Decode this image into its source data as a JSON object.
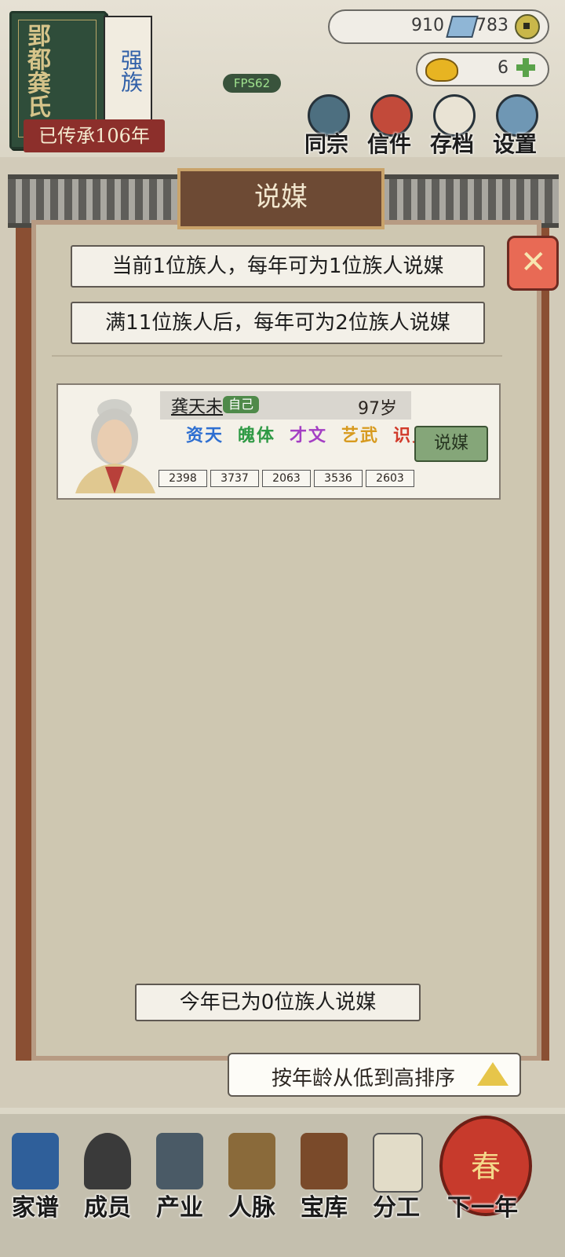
{
  "header": {
    "book_title": "郢都龚氏",
    "book_subtitle": "强族",
    "inheritance": "已传承106年",
    "resource_a": "910",
    "resource_b": "783",
    "gold": "6",
    "fps": "FPS62",
    "nav": [
      {
        "label": "同宗",
        "icon": "scroll-icon"
      },
      {
        "label": "信件",
        "icon": "letter-icon"
      },
      {
        "label": "存档",
        "icon": "brush-icon"
      },
      {
        "label": "设置",
        "icon": "gear-icon"
      }
    ]
  },
  "dialog": {
    "title": "说媒",
    "info_1": "当前1位族人，每年可为1位族人说媒",
    "info_2": "满11位族人后，每年可为2位族人说媒",
    "member": {
      "name": "龚天未",
      "self_badge": "自己",
      "age": "97岁",
      "attributes": [
        {
          "name": "天资",
          "value": "2398",
          "color": "#2e6fd1"
        },
        {
          "name": "体魄",
          "value": "3737",
          "color": "#2f9a45"
        },
        {
          "name": "文才",
          "value": "2063",
          "color": "#a43fc4"
        },
        {
          "name": "武艺",
          "value": "3536",
          "color": "#d79a1f"
        },
        {
          "name": "见识",
          "value": "2603",
          "color": "#d13a2a"
        }
      ],
      "action_label": "说媒"
    },
    "status": "今年已为0位族人说媒",
    "sort_label": "按年龄从低到高排序"
  },
  "bottom_nav": [
    {
      "label": "家谱",
      "icon": "book-icon"
    },
    {
      "label": "成员",
      "icon": "person-icon"
    },
    {
      "label": "产业",
      "icon": "building-icon"
    },
    {
      "label": "人脉",
      "icon": "network-icon"
    },
    {
      "label": "宝库",
      "icon": "chest-icon"
    },
    {
      "label": "分工",
      "icon": "scroll-icon"
    },
    {
      "label": "下一年",
      "icon": "lantern-icon",
      "badge": "春"
    }
  ]
}
